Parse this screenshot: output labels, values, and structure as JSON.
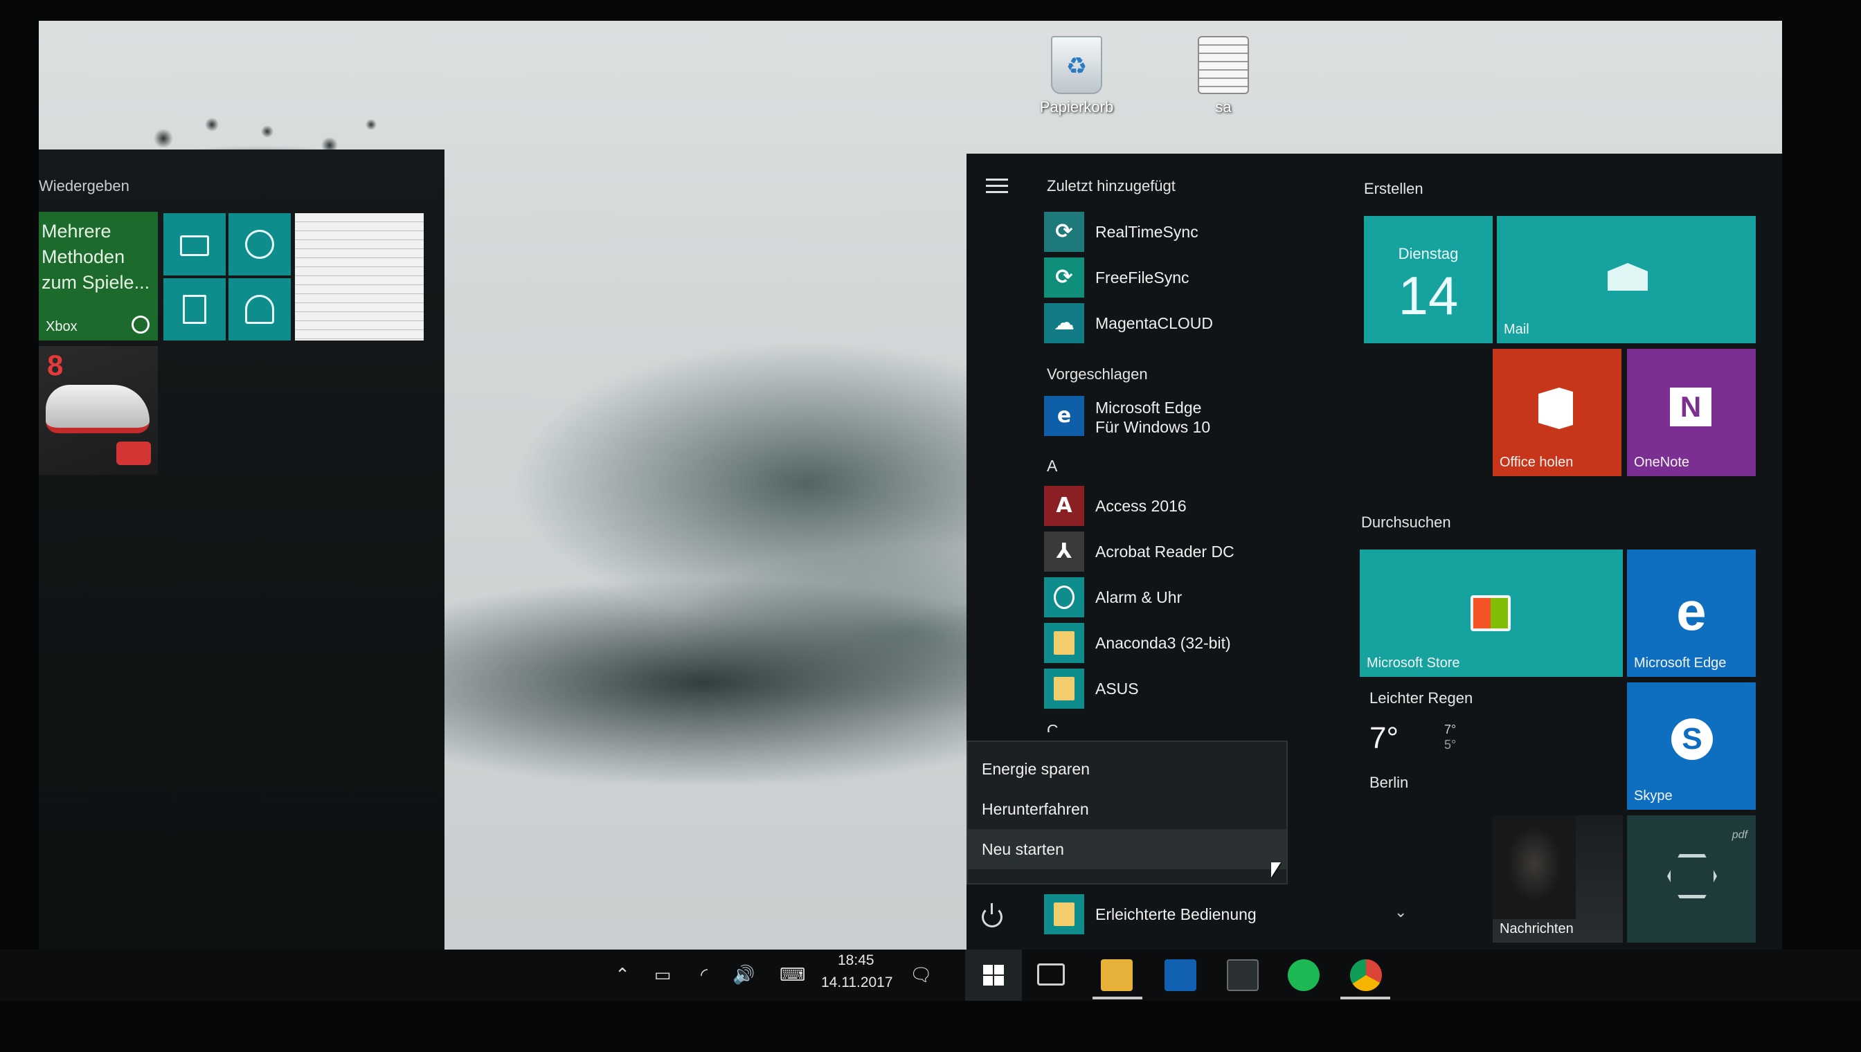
{
  "desktop": {
    "icons": [
      {
        "label": "Papierkorb"
      },
      {
        "label": "sa"
      }
    ]
  },
  "left_panel": {
    "group_title": "Wiedergeben",
    "xbox_tile": {
      "text": "Mehrere Methoden zum Spiele...",
      "label": "Xbox"
    },
    "asphalt_tile": {
      "number": "8"
    }
  },
  "start_menu": {
    "recent_header": "Zuletzt hinzugefügt",
    "recent": [
      {
        "name": "RealTimeSync",
        "icon": "realtimesync-icon",
        "glyph": "⟳"
      },
      {
        "name": "FreeFileSync",
        "icon": "freefilesync-icon",
        "glyph": "⟳"
      },
      {
        "name": "MagentaCLOUD",
        "icon": "magentacloud-icon",
        "glyph": "☁"
      }
    ],
    "suggested_header": "Vorgeschlagen",
    "suggested": {
      "name_line1": "Microsoft Edge",
      "name_line2": "Für Windows 10",
      "glyph": "e"
    },
    "letter_a": "A",
    "apps_a": [
      {
        "name": "Access 2016",
        "glyph": "A"
      },
      {
        "name": "Acrobat Reader DC",
        "glyph": "⅄"
      },
      {
        "name": "Alarm & Uhr",
        "glyph": ""
      },
      {
        "name": "Anaconda3 (32-bit)",
        "chevron": "⌄"
      },
      {
        "name": "ASUS",
        "chevron": "⌄"
      }
    ],
    "letter_c": "C",
    "power_menu": [
      {
        "label": "Energie sparen"
      },
      {
        "label": "Herunterfahren"
      },
      {
        "label": "Neu starten"
      }
    ],
    "bottom_app": {
      "name": "Erleichterte Bedienung",
      "chevron": "⌄"
    }
  },
  "tiles": {
    "group_create": "Erstellen",
    "calendar": {
      "day": "Dienstag",
      "date": "14"
    },
    "mail": {
      "label": "Mail"
    },
    "office": {
      "label": "Office holen"
    },
    "onenote": {
      "label": "OneNote",
      "glyph": "N"
    },
    "group_browse": "Durchsuchen",
    "store": {
      "label": "Microsoft Store"
    },
    "edge": {
      "label": "Microsoft Edge",
      "glyph": "e"
    },
    "weather": {
      "condition": "Leichter Regen",
      "temp": "7°",
      "high": "7°",
      "low": "5°",
      "city": "Berlin"
    },
    "skype": {
      "label": "Skype",
      "glyph": "S"
    },
    "news": {
      "label": "Nachrichten"
    },
    "pdf": {
      "tag": "pdf"
    }
  },
  "taskbar": {
    "time": "18:45",
    "date": "14.11.2017",
    "tray_glyphs": {
      "chevron": "⌃",
      "battery": "▭",
      "network": "◜",
      "volume": "🔊",
      "keyboard": "⌨",
      "notification": "🗨"
    }
  },
  "colors": {
    "tile_teal": "#16a3a0",
    "tile_office": "#c7351a",
    "tile_onenote": "#7c2f93",
    "tile_blue": "#0e6fc1",
    "xbox_green": "#1d6b2c"
  }
}
